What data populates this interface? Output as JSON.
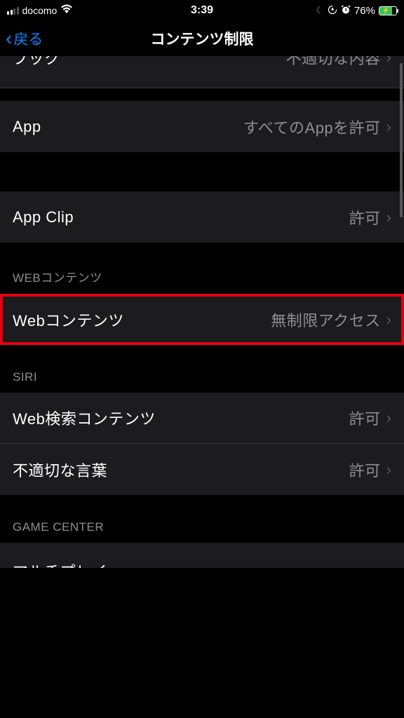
{
  "statusBar": {
    "carrier": "docomo",
    "time": "3:39",
    "batteryPercent": "76%"
  },
  "nav": {
    "back": "戻る",
    "title": "コンテンツ制限"
  },
  "rows": {
    "partial_top_label": "ブック",
    "partial_top_value": "不適切な内容",
    "app_label": "App",
    "app_value": "すべてのAppを許可",
    "appclip_label": "App Clip",
    "appclip_value": "許可",
    "webcontent_label": "Webコンテンツ",
    "webcontent_value": "無制限アクセス",
    "websearch_label": "Web検索コンテンツ",
    "websearch_value": "許可",
    "language_label": "不適切な言葉",
    "language_value": "許可",
    "partial_bottom_label": "マルチプレイ"
  },
  "sections": {
    "web": "WEBコンテンツ",
    "siri": "SIRI",
    "gamecenter": "GAME CENTER"
  }
}
